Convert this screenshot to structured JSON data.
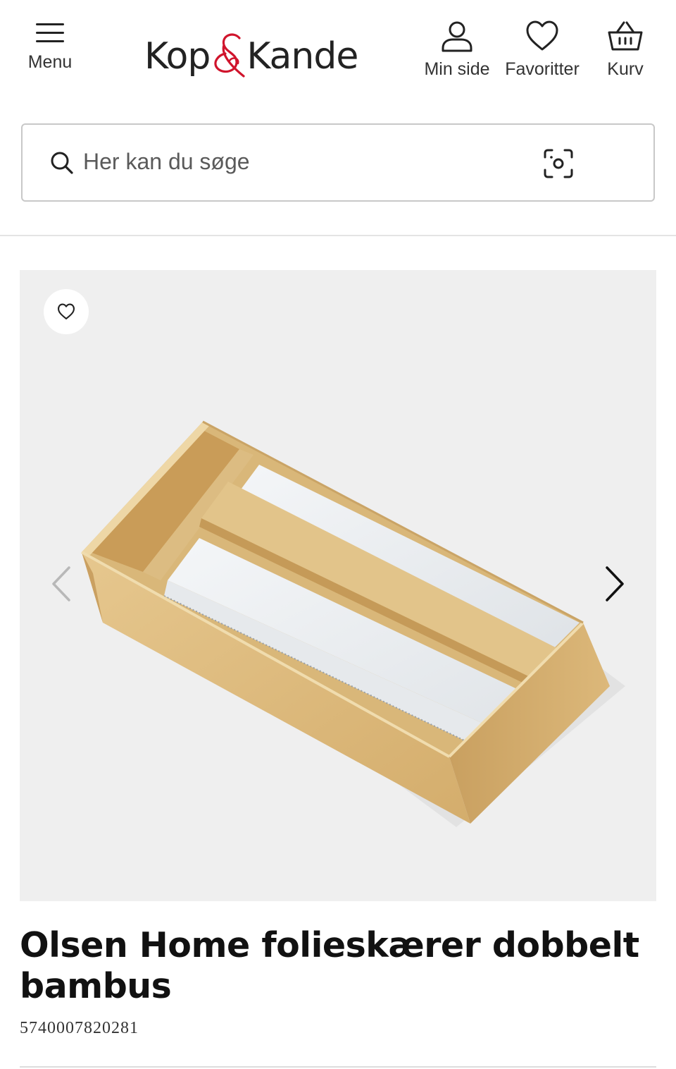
{
  "header": {
    "menu_label": "Menu",
    "logo_text_left": "Kop",
    "logo_text_right": "Kande",
    "account_label": "Min side",
    "favorites_label": "Favoritter",
    "cart_label": "Kurv"
  },
  "search": {
    "placeholder": "Her kan du søge",
    "search_icon": "search-icon",
    "camera_icon": "visual-search-camera-icon"
  },
  "product": {
    "title": "Olsen Home folieskærer dobbelt bambus",
    "sku": "5740007820281",
    "favorite_icon": "heart-icon",
    "prev_icon": "chevron-left-icon",
    "next_icon": "chevron-right-icon"
  },
  "colors": {
    "brand_red": "#d0142c",
    "text_dark": "#1a1a1a",
    "gallery_bg": "#efefef"
  }
}
